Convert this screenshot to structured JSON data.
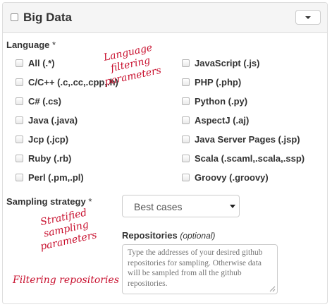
{
  "panel": {
    "title": "Big Data"
  },
  "language": {
    "label": "Language",
    "required_mark": "*",
    "options_left": [
      "All (.*)",
      "C/C++ (.c,.cc,.cpp,.h)",
      "C# (.cs)",
      "Java (.java)",
      "Jcp (.jcp)",
      "Ruby (.rb)",
      "Perl (.pm,.pl)"
    ],
    "options_right": [
      "JavaScript (.js)",
      "PHP (.php)",
      "Python (.py)",
      "AspectJ (.aj)",
      "Java Server Pages (.jsp)",
      "Scala (.scaml,.scala,.ssp)",
      "Groovy (.groovy)"
    ]
  },
  "sampling": {
    "label": "Sampling strategy",
    "required_mark": "*",
    "selected": "Best cases"
  },
  "repositories": {
    "label": "Repositories",
    "optional": "(optional)",
    "placeholder": "Type the addresses of your desired github repositories for sampling. Otherwise data will be sampled from all the github repositories."
  },
  "annotations": {
    "language": "Language filtering parameters",
    "sampling": "Stratified sampling parameters",
    "repositories": "Filtering repositories"
  },
  "colors": {
    "annotation": "#c8102e",
    "header_bg": "#f5f5f5",
    "border": "#dddddd"
  }
}
